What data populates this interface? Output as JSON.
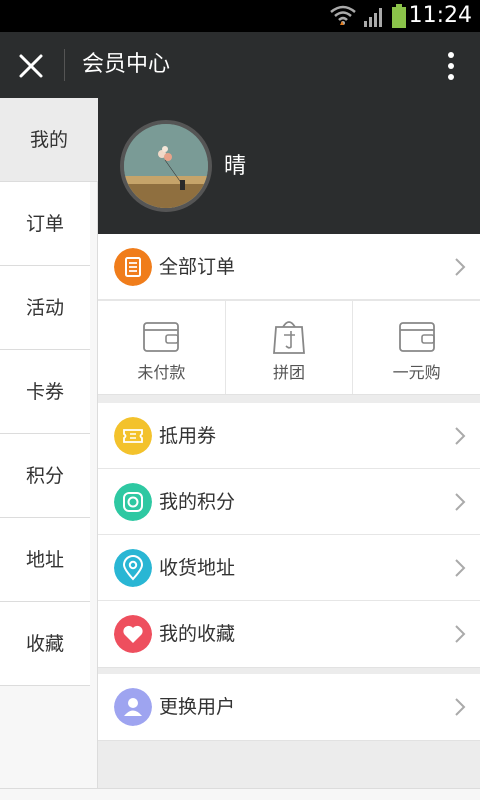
{
  "status_bar": {
    "time": "11:24"
  },
  "title_bar": {
    "title": "会员中心"
  },
  "sidebar": {
    "items": [
      {
        "label": "我的",
        "active": true
      },
      {
        "label": "订单"
      },
      {
        "label": "活动"
      },
      {
        "label": "卡券"
      },
      {
        "label": "积分"
      },
      {
        "label": "地址"
      },
      {
        "label": "收藏"
      }
    ]
  },
  "profile": {
    "name": "晴"
  },
  "orders": {
    "label": "全部订单",
    "icon": "orders-list-icon",
    "color": "#f07d1b",
    "shortcuts": [
      {
        "label": "未付款",
        "icon": "wallet-icon"
      },
      {
        "label": "拼团",
        "icon": "shopping-bag-icon"
      },
      {
        "label": "一元购",
        "icon": "wallet-icon"
      }
    ]
  },
  "menu": [
    {
      "label": "抵用券",
      "icon": "coupon-icon",
      "color": "#f3c22c"
    },
    {
      "label": "我的积分",
      "icon": "points-icon",
      "color": "#2ec8a2"
    },
    {
      "label": "收货地址",
      "icon": "location-pin-icon",
      "color": "#29b6d4"
    },
    {
      "label": "我的收藏",
      "icon": "heart-icon",
      "color": "#ee4f5e"
    }
  ],
  "switch_user": {
    "label": "更换用户",
    "icon": "user-icon",
    "color": "#9ea4f0"
  }
}
